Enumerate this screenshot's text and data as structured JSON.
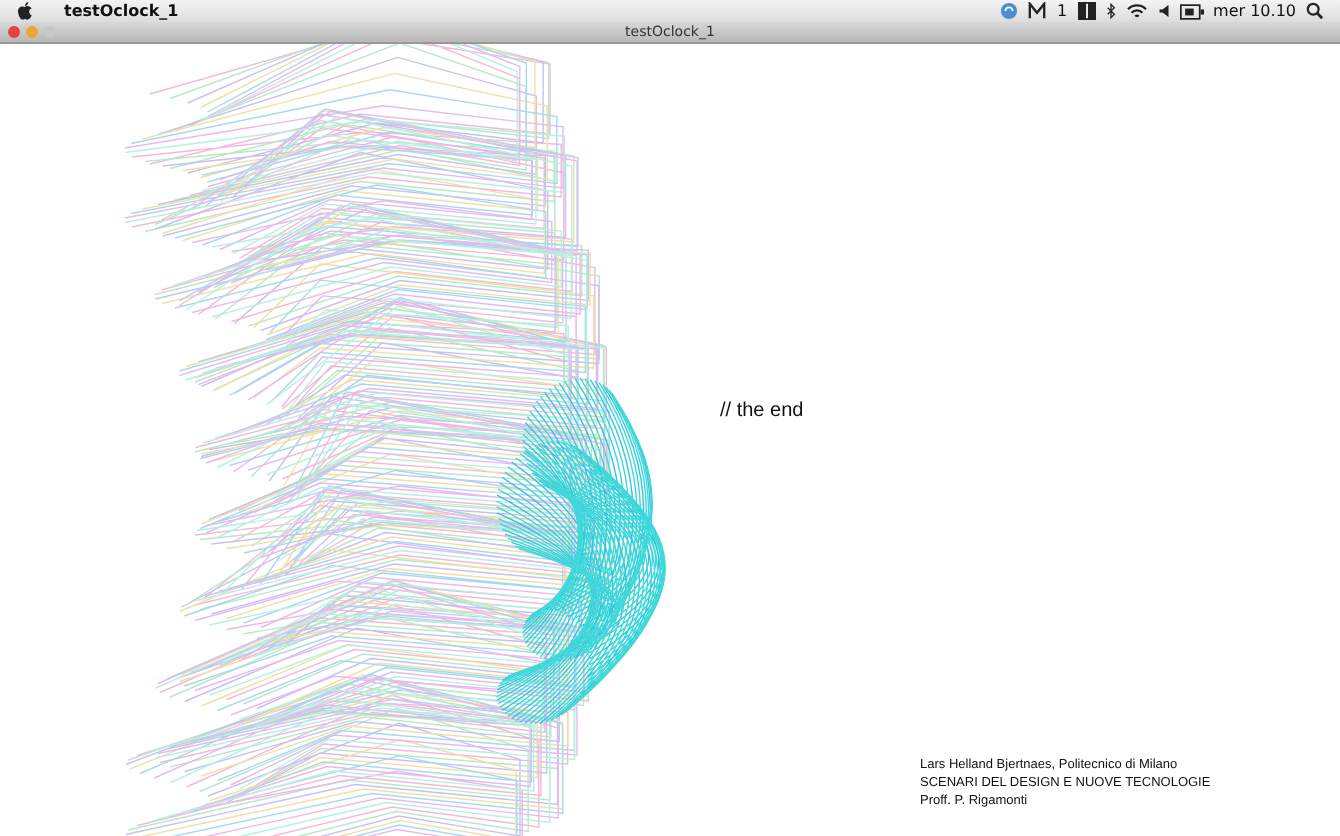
{
  "menubar": {
    "app_name": "testOclock_1",
    "badge": "1",
    "clock": "mer 10.10"
  },
  "window": {
    "title": "testOclock_1"
  },
  "canvas": {
    "caption": "// the end",
    "credits": [
      "Lars Helland Bjertnaes, Politecnico di Milano",
      "SCENARI DEL DESIGN E NUOVE TECNOLOGIE",
      "Proff. P. Rigamonti"
    ]
  }
}
